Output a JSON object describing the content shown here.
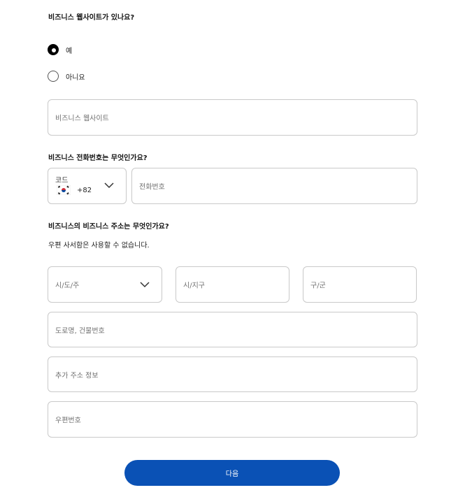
{
  "website_section": {
    "question": "비즈니스 웹사이트가 있나요?",
    "options": [
      {
        "label": "예",
        "selected": true
      },
      {
        "label": "아니요",
        "selected": false
      }
    ],
    "website_placeholder": "비즈니스 웹사이트"
  },
  "phone_section": {
    "question": "비즈니스 전화번호는 무엇인가요?",
    "code_label": "코드",
    "country_code": "+82",
    "country_flag_icon": "south-korea-flag-icon",
    "phone_placeholder": "전화번호"
  },
  "address_section": {
    "question": "비즈니스의 비즈니스 주소는 무엇인가요?",
    "note": "우편 사서함은 사용할 수 없습니다.",
    "state_placeholder": "시/도/주",
    "city_placeholder": "시/지구",
    "district_placeholder": "구/군",
    "street_placeholder": "도로명, 건물번호",
    "extra_placeholder": "추가 주소 정보",
    "postal_placeholder": "우편번호"
  },
  "next_button": {
    "label": "다음"
  },
  "colors": {
    "primary_button": "#0a51b5",
    "border": "#c9c9c9"
  }
}
